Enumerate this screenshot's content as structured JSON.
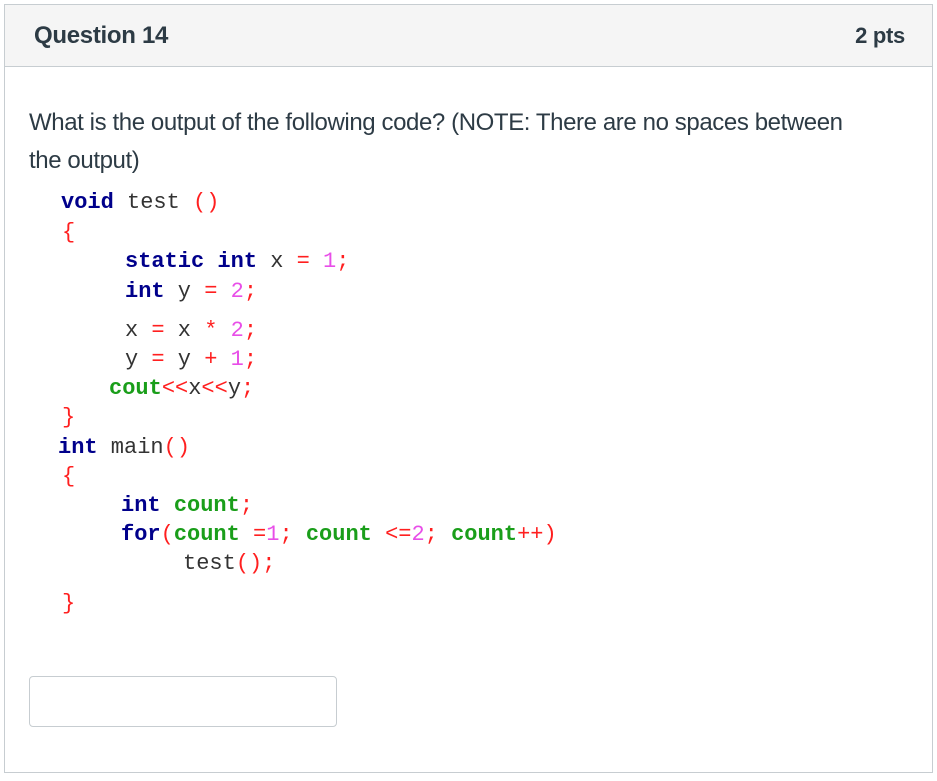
{
  "question": {
    "title": "Question 14",
    "points": "2 pts",
    "prompt": "What is the output of the following code? (NOTE: There are no spaces between the output)"
  },
  "code": {
    "language": "C++",
    "lines": [
      [
        {
          "t": "void",
          "c": "kw"
        },
        {
          "t": " test ",
          "c": "id"
        },
        {
          "t": "()",
          "c": "op"
        }
      ],
      [
        {
          "t": "{",
          "c": "op"
        }
      ],
      [
        {
          "t": "static",
          "c": "kw"
        },
        {
          "t": " ",
          "c": "id"
        },
        {
          "t": "int",
          "c": "kw"
        },
        {
          "t": " x ",
          "c": "id"
        },
        {
          "t": "=",
          "c": "op"
        },
        {
          "t": " ",
          "c": "id"
        },
        {
          "t": "1",
          "c": "num"
        },
        {
          "t": ";",
          "c": "op"
        }
      ],
      [
        {
          "t": "int",
          "c": "kw"
        },
        {
          "t": " y ",
          "c": "id"
        },
        {
          "t": "=",
          "c": "op"
        },
        {
          "t": " ",
          "c": "id"
        },
        {
          "t": "2",
          "c": "num"
        },
        {
          "t": ";",
          "c": "op"
        }
      ],
      [
        {
          "t": "x ",
          "c": "id"
        },
        {
          "t": "=",
          "c": "op"
        },
        {
          "t": " x ",
          "c": "id"
        },
        {
          "t": "*",
          "c": "op"
        },
        {
          "t": " ",
          "c": "id"
        },
        {
          "t": "2",
          "c": "num"
        },
        {
          "t": ";",
          "c": "op"
        }
      ],
      [
        {
          "t": "y ",
          "c": "id"
        },
        {
          "t": "=",
          "c": "op"
        },
        {
          "t": " y ",
          "c": "id"
        },
        {
          "t": "+",
          "c": "op"
        },
        {
          "t": " ",
          "c": "id"
        },
        {
          "t": "1",
          "c": "num"
        },
        {
          "t": ";",
          "c": "op"
        }
      ],
      [
        {
          "t": "cout",
          "c": "grn"
        },
        {
          "t": "<<",
          "c": "op"
        },
        {
          "t": "x",
          "c": "id"
        },
        {
          "t": "<<",
          "c": "op"
        },
        {
          "t": "y",
          "c": "id"
        },
        {
          "t": ";",
          "c": "op"
        }
      ],
      [
        {
          "t": "}",
          "c": "op"
        }
      ],
      [
        {
          "t": "int",
          "c": "kw"
        },
        {
          "t": " main",
          "c": "id"
        },
        {
          "t": "()",
          "c": "op"
        }
      ],
      [
        {
          "t": "{",
          "c": "op"
        }
      ],
      [
        {
          "t": "int",
          "c": "kw"
        },
        {
          "t": " ",
          "c": "id"
        },
        {
          "t": "count",
          "c": "grn"
        },
        {
          "t": ";",
          "c": "op"
        }
      ],
      [
        {
          "t": "for",
          "c": "kw"
        },
        {
          "t": "(",
          "c": "op"
        },
        {
          "t": "count",
          "c": "grn"
        },
        {
          "t": " ",
          "c": "id"
        },
        {
          "t": "=",
          "c": "op"
        },
        {
          "t": "1",
          "c": "num"
        },
        {
          "t": ";",
          "c": "op"
        },
        {
          "t": " ",
          "c": "id"
        },
        {
          "t": "count",
          "c": "grn"
        },
        {
          "t": " ",
          "c": "id"
        },
        {
          "t": "<=",
          "c": "op"
        },
        {
          "t": "2",
          "c": "num"
        },
        {
          "t": ";",
          "c": "op"
        },
        {
          "t": " ",
          "c": "id"
        },
        {
          "t": "count",
          "c": "grn"
        },
        {
          "t": "++)",
          "c": "op"
        }
      ],
      [
        {
          "t": "test",
          "c": "id"
        },
        {
          "t": "();",
          "c": "op"
        }
      ],
      [
        {
          "t": "}",
          "c": "op"
        }
      ]
    ]
  },
  "answer_input": {
    "value": "",
    "placeholder": ""
  }
}
